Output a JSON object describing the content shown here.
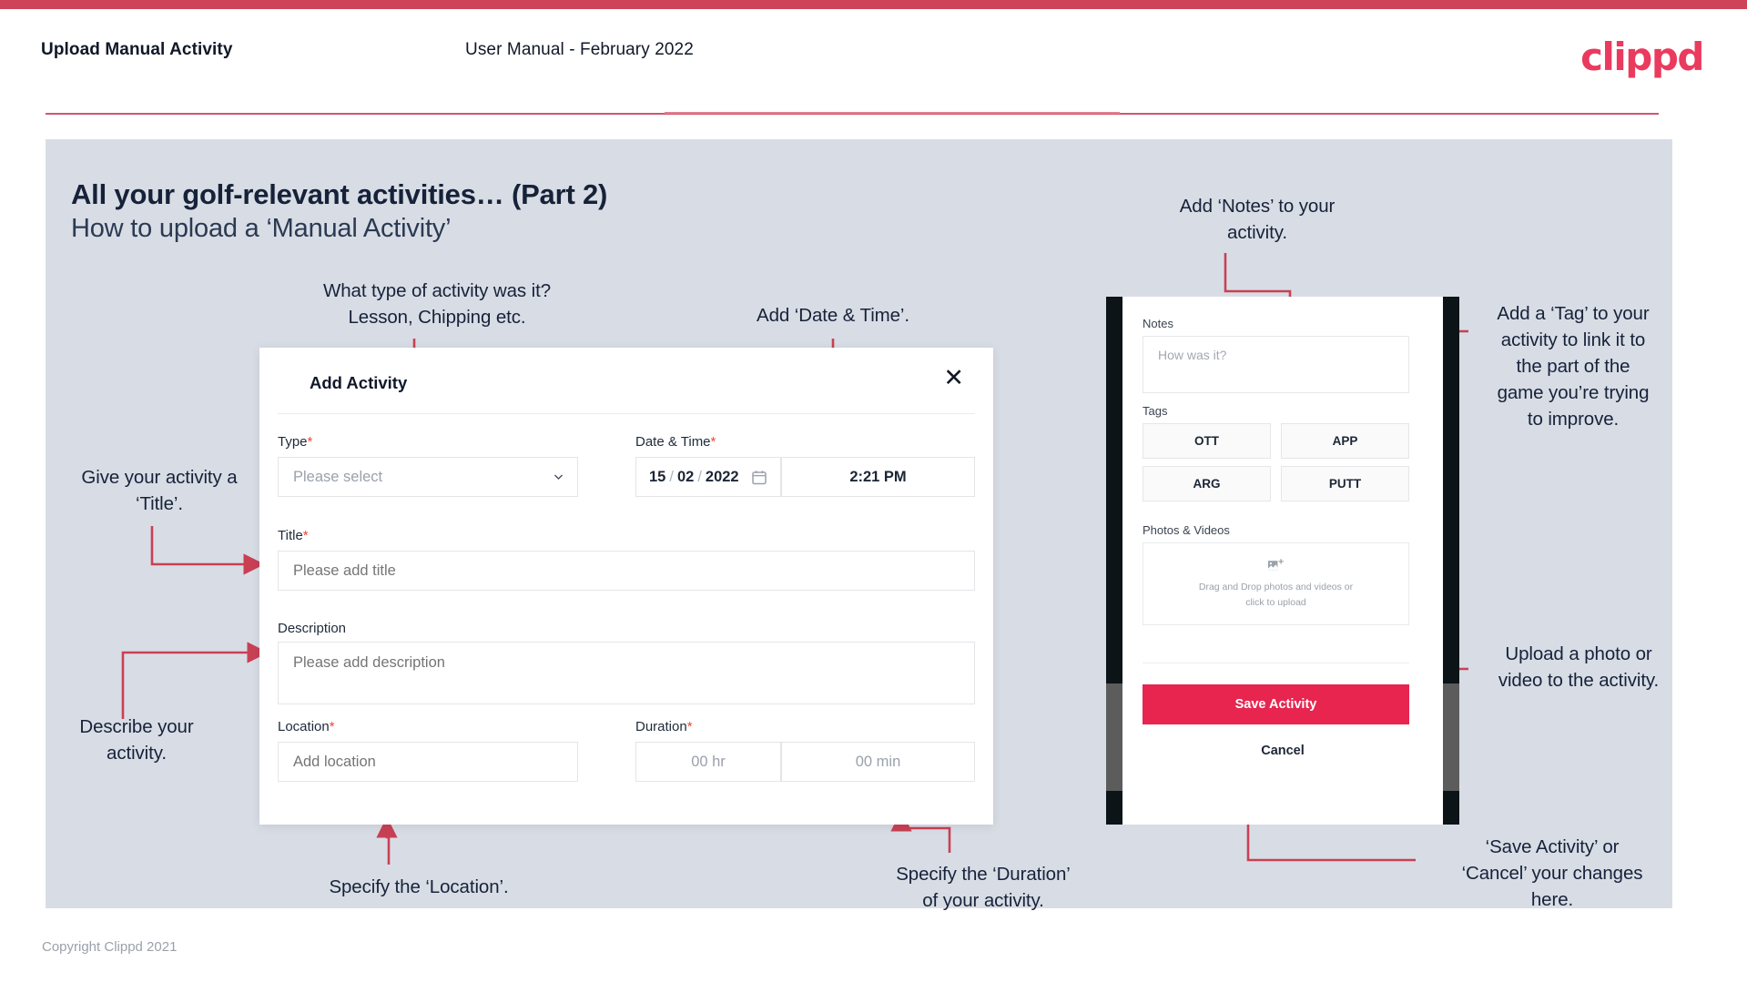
{
  "header": {
    "title": "Upload Manual Activity",
    "subtitle": "User Manual - February 2022",
    "logo": "clippd",
    "accent_color": "#ea3a5e",
    "strip_color": "#cf4358"
  },
  "slide": {
    "heading": "All your golf-relevant activities… (Part 2)",
    "subheading": "How to upload a ‘Manual Activity’",
    "background_color": "#d8dde5"
  },
  "annotations": {
    "type": "What type of activity was it?\nLesson, Chipping etc.",
    "type_line1": "What type of activity was it?",
    "type_line2": "Lesson, Chipping etc.",
    "datetime": "Add ‘Date & Time’.",
    "title": "Give your activity a\n‘Title’.",
    "title_line1": "Give your activity a",
    "title_line2": "‘Title’.",
    "description_line1": "Describe your",
    "description_line2": "activity.",
    "location": "Specify the ‘Location’.",
    "duration_line1": "Specify the ‘Duration’",
    "duration_line2": "of your activity.",
    "notes_line1": "Add ‘Notes’ to your",
    "notes_line2": "activity.",
    "tag_line1": "Add a ‘Tag’ to your",
    "tag_line2": "activity to link it to",
    "tag_line3": "the part of the",
    "tag_line4": "game you’re trying",
    "tag_line5": "to improve.",
    "upload_line1": "Upload a photo or",
    "upload_line2": "video to the activity.",
    "save_line1": "‘Save Activity’ or",
    "save_line2": "‘Cancel’ your changes",
    "save_line3": "here.",
    "arrow_color": "#c94055"
  },
  "modal": {
    "title": "Add Activity",
    "close_icon": "close-icon",
    "fields": {
      "type_label": "Type",
      "type_value": "Please select",
      "type_required": "*",
      "datetime_label": "Date & Time",
      "datetime_required": "*",
      "date_day": "15",
      "date_sep1": "/",
      "date_month": "02",
      "date_sep2": "/",
      "date_year": "2022",
      "calendar_icon": "calendar-icon",
      "time_value": "2:21 PM",
      "title_label": "Title",
      "title_required": "*",
      "title_placeholder": "Please add title",
      "description_label": "Description",
      "description_placeholder": "Please add description",
      "location_label": "Location",
      "location_required": "*",
      "location_placeholder": "Add location",
      "duration_label": "Duration",
      "duration_required": "*",
      "duration_hr": "00 hr",
      "duration_min": "00 min"
    }
  },
  "phone": {
    "notes_label": "Notes",
    "notes_placeholder": "How was it?",
    "tags_label": "Tags",
    "tags": [
      "OTT",
      "APP",
      "ARG",
      "PUTT"
    ],
    "photos_label": "Photos & Videos",
    "drop_icon": "add-image-icon",
    "drop_line1": "Drag and Drop photos and videos or",
    "drop_line2": "click to upload",
    "save_label": "Save Activity",
    "save_color": "#e7254f",
    "cancel_label": "Cancel"
  },
  "footer": {
    "copyright": "Copyright Clippd 2021"
  }
}
